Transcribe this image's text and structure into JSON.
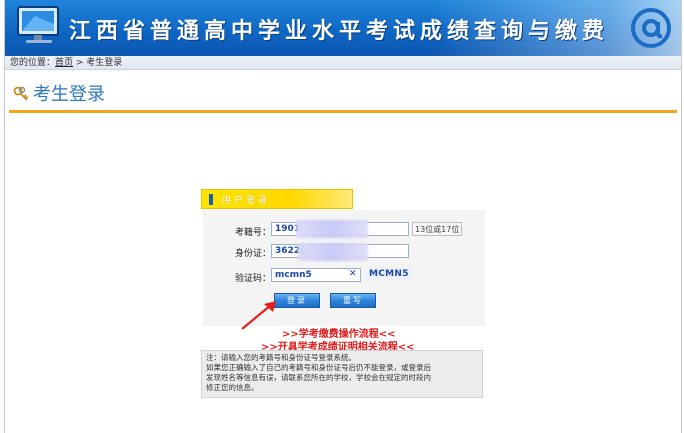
{
  "banner": {
    "title": "江西省普通高中学业水平考试成绩查询与缴费"
  },
  "breadcrumb": {
    "prefix": "您的位置：",
    "home": "首页",
    "separator": " > ",
    "current": "考生登录"
  },
  "page": {
    "title": "考生登录"
  },
  "login": {
    "header": "用户登录",
    "exam_no_label": "考籍号：",
    "exam_no_value": "1901",
    "exam_no_hint": "13位或17位",
    "id_label": "身份证：",
    "id_value": "3622(",
    "captcha_label": "验证码：",
    "captcha_value": "mcmn5",
    "clear_symbol": "✕",
    "captcha_code": "MCMN5",
    "login_button": "登录",
    "reset_button": "重写"
  },
  "links": {
    "pay_flow": ">>学考缴费操作流程<<",
    "certificate_flow": ">>开具学考成绩证明相关流程<<"
  },
  "notice": {
    "line1": "注：请输入您的考籍号和身份证号登录系统。",
    "line2": "如果您正确输入了自己的考籍号和身份证号后仍不能登录，或登录后",
    "line3": "发现姓名等信息有误，请联系您所在的学校，学校会在规定的时段内",
    "line4": "修正您的信息。"
  },
  "colors": {
    "banner": "#0f67c4",
    "title": "#2a78c6",
    "rule": "#f6a21a",
    "tab": "#ffe300",
    "link": "#e01b1b"
  },
  "icons": {
    "monitor": "monitor-icon",
    "at": "at-sign-icon",
    "keys": "keys-icon",
    "arrow": "red-arrow-icon"
  }
}
